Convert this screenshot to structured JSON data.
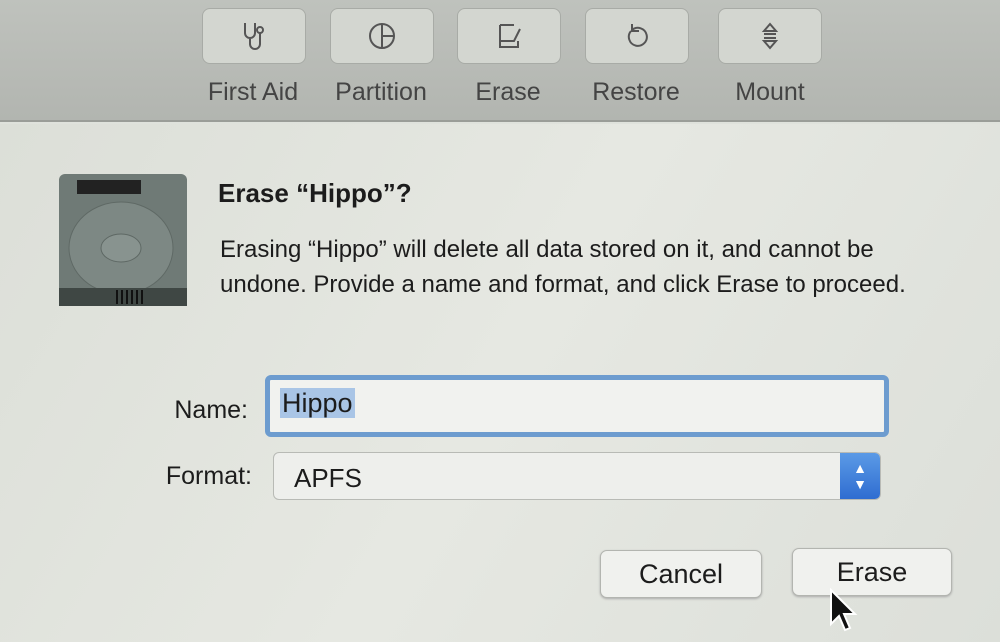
{
  "toolbar": {
    "items": [
      {
        "label": "First Aid",
        "icon": "stethoscope-icon"
      },
      {
        "label": "Partition",
        "icon": "pie-chart-icon"
      },
      {
        "label": "Erase",
        "icon": "eraser-icon"
      },
      {
        "label": "Restore",
        "icon": "restore-icon"
      },
      {
        "label": "Mount",
        "icon": "mount-icon"
      }
    ]
  },
  "dialog": {
    "icon": "hard-drive-icon",
    "title": "Erase “Hippo”?",
    "message": "Erasing “Hippo” will delete all data stored on it, and cannot be undone. Provide a name and format, and click Erase to proceed.",
    "name_label": "Name:",
    "name_value": "Hippo",
    "format_label": "Format:",
    "format_value": "APFS",
    "cancel_label": "Cancel",
    "erase_label": "Erase",
    "accent_color": "#3b7bd9"
  }
}
